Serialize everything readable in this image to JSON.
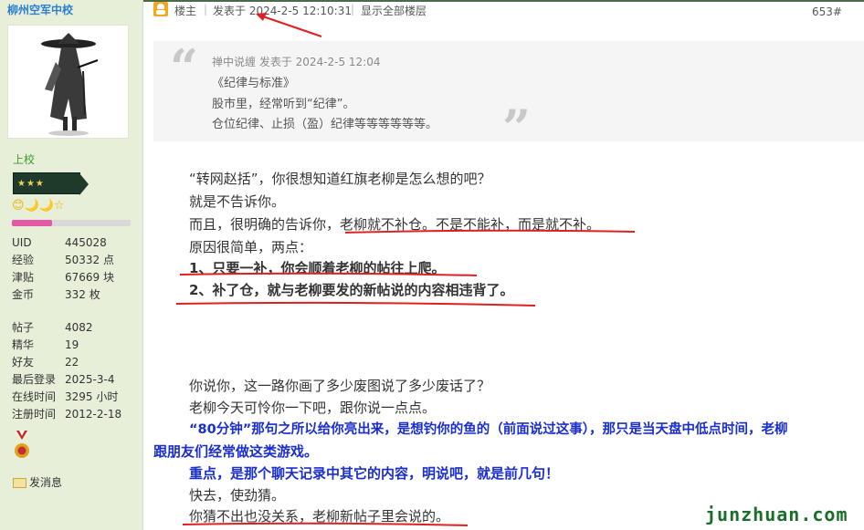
{
  "sidebar": {
    "username": "柳州空军中校",
    "rank": "上校",
    "rank_badge": "★★★",
    "level_icons": "😊🌙🌙☆",
    "progress": 0.34,
    "stats": [
      {
        "label": "UID",
        "value": "445028"
      },
      {
        "label": "经验",
        "value": "50332 点"
      },
      {
        "label": "津贴",
        "value": "67669 块"
      },
      {
        "label": "金币",
        "value": "332 枚"
      }
    ],
    "stats2": [
      {
        "label": "帖子",
        "value": "4082"
      },
      {
        "label": "精华",
        "value": "19"
      },
      {
        "label": "好友",
        "value": "22"
      },
      {
        "label": "最后登录",
        "value": "2025-3-4"
      },
      {
        "label": "在线时间",
        "value": "3295 小时"
      },
      {
        "label": "注册时间",
        "value": "2012-2-18"
      }
    ],
    "pm_label": "发消息"
  },
  "post_header": {
    "louzhu": "楼主",
    "posted_at": "发表于 2024-2-5 12:10:31",
    "show_all": "显示全部楼层",
    "floor": "653#"
  },
  "quote": {
    "meta": "禅中说缠 发表于 2024-2-5 12:04",
    "lines": [
      "《纪律与标准》",
      "股市里，经常听到“纪律”。",
      "仓位纪律、止损（盈）纪律等等等等等等。"
    ]
  },
  "body": {
    "p1": "“转网赵括”，你很想知道红旗老柳是怎么想的吧？",
    "p2": "就是不告诉你。",
    "p3": "而且，很明确的告诉你，老柳就不补仓。不是不能补，而是就不补。",
    "p4": "原因很简单，两点：",
    "p5": "1、只要一补，你会顺着老柳的帖往上爬。",
    "p6": "2、补了仓，就与老柳要发的新帖说的内容相违背了。",
    "p7": "你说你，这一路你画了多少废图说了多少废话了？",
    "p8": "老柳今天可怜你一下吧，跟你说一点点。",
    "p9a": "“80分钟”那句之所以给你亮出来，是想钓你的鱼的（前面说过这事），那只是当天盘中低点时间，老柳",
    "p9b": "跟朋友们经常做这类游戏。",
    "p10": "重点，是那个聊天记录中其它的内容，明说吧，就是前几句！",
    "p11": "快去，使劲猜。",
    "p12": "你猜不出也没关系，老柳新帖子里会说的。"
  },
  "watermark": "junzhuan.com",
  "colors": {
    "annotation": "#e02020",
    "blue_text": "#1a2ed0",
    "sidebar_bg": "#e8efd9"
  }
}
